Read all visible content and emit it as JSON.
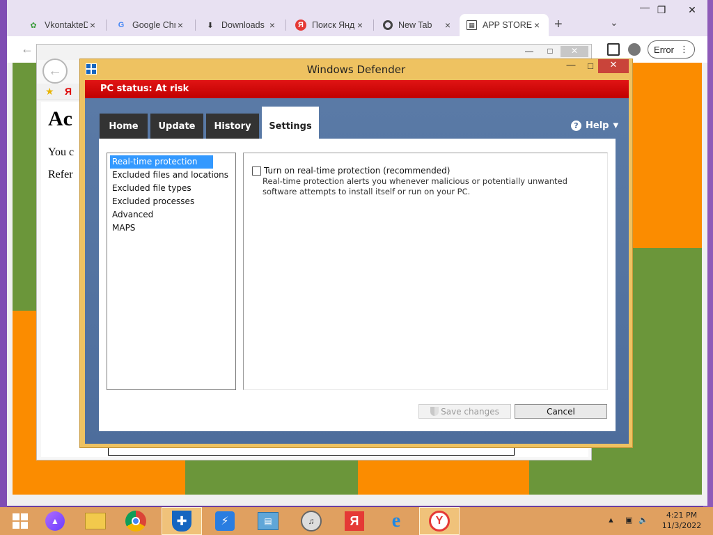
{
  "browser": {
    "tabs": [
      {
        "title": "VkontakteD",
        "icon": "vk-leaf-icon"
      },
      {
        "title": "Google Chr",
        "icon": "google-icon"
      },
      {
        "title": "Downloads",
        "icon": "download-icon"
      },
      {
        "title": "Поиск Янд",
        "icon": "yandex-icon"
      },
      {
        "title": "New Tab",
        "icon": "chrome-icon"
      },
      {
        "title": "APP STORE",
        "icon": "grid-icon"
      }
    ],
    "new_tab_glyph": "+",
    "error_label": "Error"
  },
  "ie_page": {
    "heading": "Ac",
    "line1": "You c",
    "line2": "Refer",
    "ya_glyph": "Я"
  },
  "defender": {
    "window_title": "Windows Defender",
    "status": "PC status: At risk",
    "tabs": [
      {
        "label": "Home"
      },
      {
        "label": "Update"
      },
      {
        "label": "History"
      },
      {
        "label": "Settings"
      }
    ],
    "active_tab": "Settings",
    "help_label": "Help",
    "settings_list": [
      "Real-time protection",
      "Excluded files and locations",
      "Excluded file types",
      "Excluded processes",
      "Advanced",
      "MAPS"
    ],
    "selected_item": "Real-time protection",
    "checkbox_label": "Turn on real-time protection (recommended)",
    "checkbox_checked": false,
    "description": "Real-time protection alerts you whenever malicious or potentially unwanted software attempts to install itself or run on your PC.",
    "save_label": "Save changes",
    "cancel_label": "Cancel"
  },
  "taskbar": {
    "time": "4:21 PM",
    "date": "11/3/2022"
  },
  "colors": {
    "status_red": "#d00000",
    "defender_frame": "#eec261",
    "selection_blue": "#3399ff",
    "taskbar": "#e0a060"
  }
}
